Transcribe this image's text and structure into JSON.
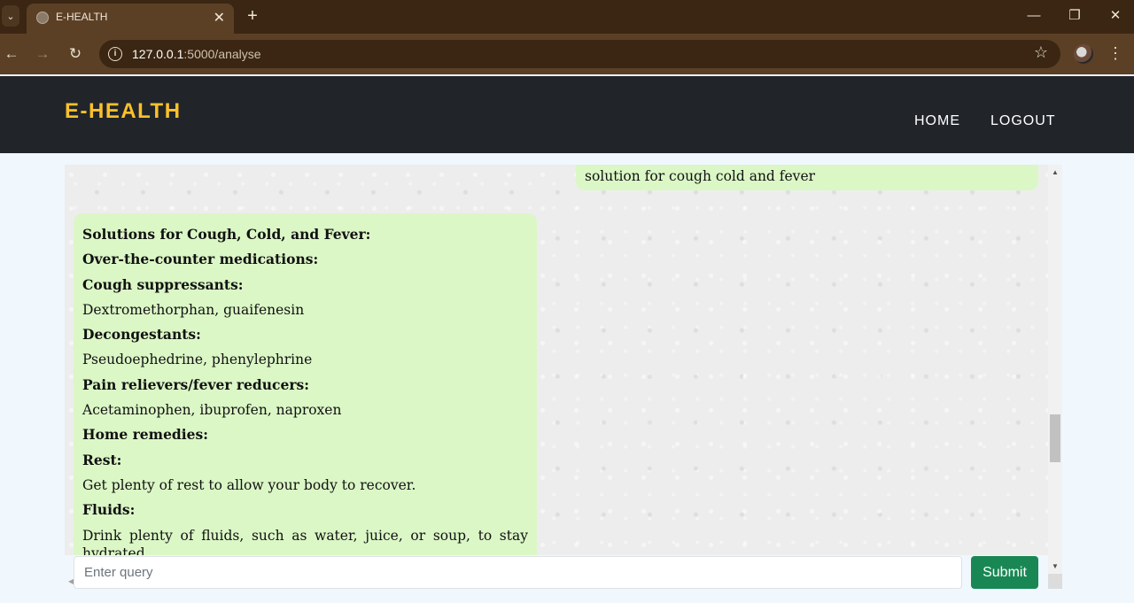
{
  "browser": {
    "tab_title": "E-HEALTH",
    "tab_close": "✕",
    "new_tab": "+",
    "url_host": "127.0.0.1",
    "url_path": ":5000/analyse",
    "icons": {
      "tab_list": "chevron-down-icon",
      "favicon": "globe-icon",
      "back": "back-arrow-icon",
      "forward": "forward-arrow-icon",
      "reload": "reload-icon",
      "site_info": "info-icon",
      "bookmark": "star-icon",
      "profile": "avatar",
      "menu": "more-vert-icon"
    },
    "colors": {
      "frame": "#3a2612",
      "toolbar": "#5b4026"
    }
  },
  "site": {
    "brand": "E-HEALTH",
    "nav": [
      {
        "label": "HOME"
      },
      {
        "label": "LOGOUT"
      }
    ],
    "colors": {
      "header_bg": "#212529",
      "brand": "#fbc02d",
      "bubble": "#dbf7c6",
      "submit": "#198754"
    }
  },
  "chat": {
    "user_message": "solution for cough cold and fever",
    "bot_lines": [
      {
        "text": "Solutions for Cough, Cold, and Fever:",
        "bold": true
      },
      {
        "text": "Over-the-counter medications:",
        "bold": true
      },
      {
        "text": "Cough suppressants:",
        "bold": true
      },
      {
        "text": "Dextromethorphan, guaifenesin",
        "bold": false
      },
      {
        "text": "Decongestants:",
        "bold": true
      },
      {
        "text": "Pseudoephedrine, phenylephrine",
        "bold": false
      },
      {
        "text": "Pain relievers/fever reducers:",
        "bold": true
      },
      {
        "text": "Acetaminophen, ibuprofen, naproxen",
        "bold": false
      },
      {
        "text": "Home remedies:",
        "bold": true
      },
      {
        "text": "Rest:",
        "bold": true
      },
      {
        "text": "Get plenty of rest to allow your body to recover.",
        "bold": false
      },
      {
        "text": "Fluids:",
        "bold": true
      },
      {
        "text": "Drink plenty of fluids, such as water, juice, or soup, to stay hydrated.",
        "bold": false
      }
    ]
  },
  "form": {
    "query_placeholder": "Enter query",
    "query_value": "",
    "submit_label": "Submit"
  }
}
